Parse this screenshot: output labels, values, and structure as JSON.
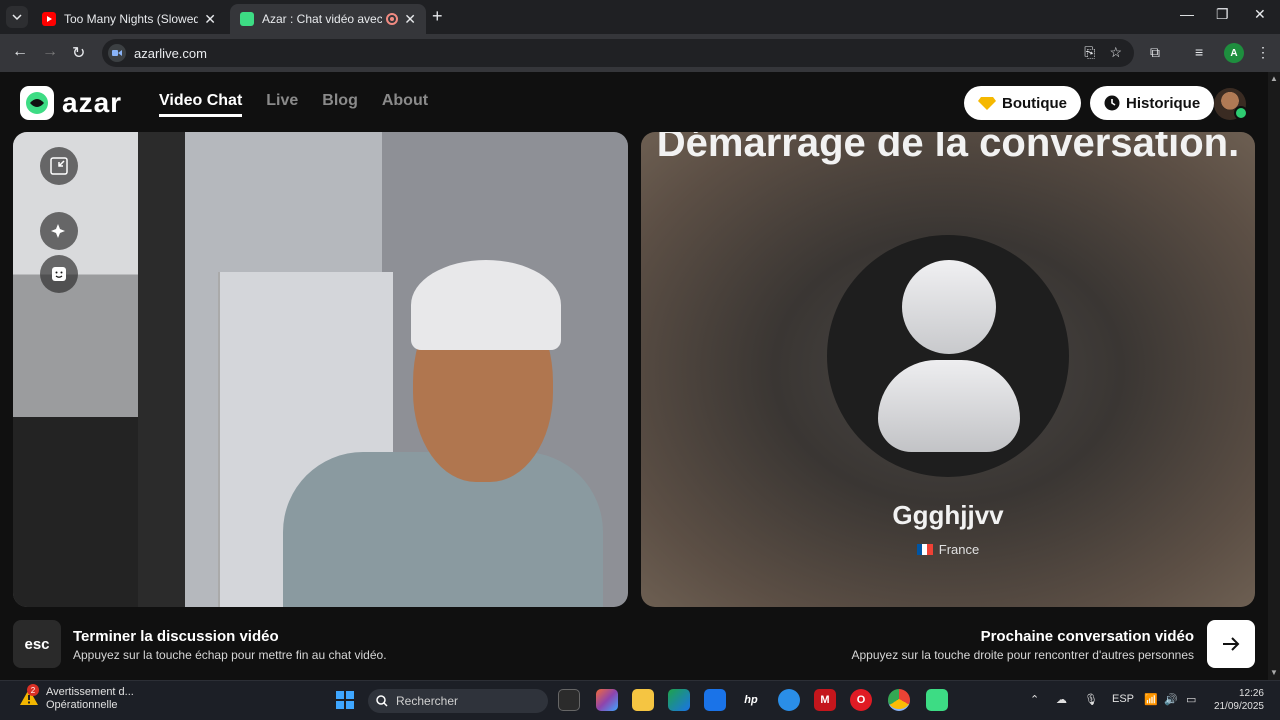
{
  "browser": {
    "tabs": [
      {
        "title": "Too Many Nights (Slowed + Re",
        "active": false,
        "favicon": "youtube-icon"
      },
      {
        "title": "Azar : Chat vidéo avec de n",
        "active": true,
        "favicon": "azar-icon"
      }
    ],
    "url": "azarlive.com",
    "profile_initial": "A"
  },
  "site": {
    "logo_text": "azar",
    "nav": [
      {
        "label": "Video Chat",
        "active": true
      },
      {
        "label": "Live",
        "active": false
      },
      {
        "label": "Blog",
        "active": false
      },
      {
        "label": "About",
        "active": false
      }
    ],
    "boutique_label": "Boutique",
    "historique_label": "Historique"
  },
  "remote": {
    "status_title": "Démarrage de la conversation.",
    "name": "Ggghjjvv",
    "country": "France"
  },
  "controls": {
    "esc_key": "esc",
    "end_title": "Terminer la discussion vidéo",
    "end_sub": "Appuyez sur la touche échap pour mettre fin au chat vidéo.",
    "next_title": "Prochaine conversation vidéo",
    "next_sub": "Appuyez sur la touche droite pour rencontrer d'autres personnes"
  },
  "taskbar": {
    "notification_count": "2",
    "notification_title": "Avertissement d...",
    "notification_sub": "Opérationnelle",
    "search_placeholder": "Rechercher",
    "language": "ESP",
    "time": "12:26",
    "date": "21/09/2025"
  },
  "colors": {
    "accent_green": "#2ecc71",
    "page_bg": "#101010"
  }
}
